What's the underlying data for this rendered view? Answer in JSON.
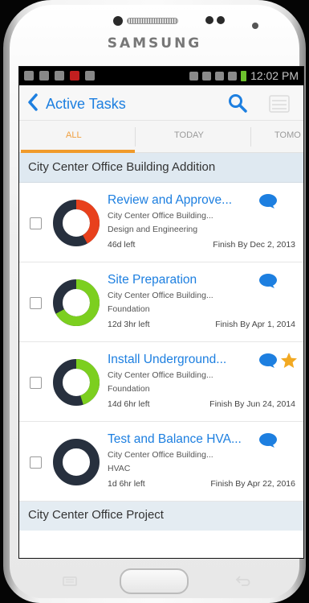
{
  "device": {
    "brand": "SAMSUNG"
  },
  "status_bar": {
    "time": "12:02 PM"
  },
  "app_bar": {
    "title": "Active Tasks"
  },
  "tabs": [
    {
      "label": "ALL",
      "active": true
    },
    {
      "label": "TODAY",
      "active": false
    },
    {
      "label": "TOMO",
      "active": false
    }
  ],
  "sections": [
    {
      "title": "City Center Office Building Addition",
      "tasks": [
        {
          "title": "Review and Approve...",
          "project": "City Center Office Building...",
          "category": "Design and Engineering",
          "time_left": "46d left",
          "finish": "Finish By Dec 2, 2013",
          "percent": 42,
          "percent_label": "42%",
          "color": "#e8401c",
          "has_comment": true,
          "starred": false
        },
        {
          "title": "Site Preparation",
          "project": "City Center Office Building...",
          "category": "Foundation",
          "time_left": "12d 3hr left",
          "finish": "Finish By Apr 1, 2014",
          "percent": 67,
          "percent_label": "67%",
          "color": "#7ccf1f",
          "has_comment": true,
          "starred": false
        },
        {
          "title": "Install Underground...",
          "project": "City Center Office Building...",
          "category": "Foundation",
          "time_left": "14d 6hr left",
          "finish": "Finish By Jun 24, 2014",
          "percent": 45,
          "percent_label": "45%",
          "color": "#7ccf1f",
          "has_comment": true,
          "starred": true
        },
        {
          "title": "Test and Balance HVA...",
          "project": "City Center Office Building...",
          "category": "HVAC",
          "time_left": "1d 6hr left",
          "finish": "Finish By Apr 22, 2016",
          "percent": 0,
          "percent_label": "0%",
          "color": "#7ccf1f",
          "has_comment": true,
          "starred": false
        }
      ]
    },
    {
      "title": "City Center Office Project"
    }
  ],
  "colors": {
    "accent_blue": "#1d7fe0",
    "tab_orange": "#f09a2a",
    "donut_track": "#27303e",
    "star": "#f2a922"
  },
  "icons": [
    "back-chevron-icon",
    "search-icon",
    "menu-icon",
    "comment-icon",
    "star-icon"
  ]
}
